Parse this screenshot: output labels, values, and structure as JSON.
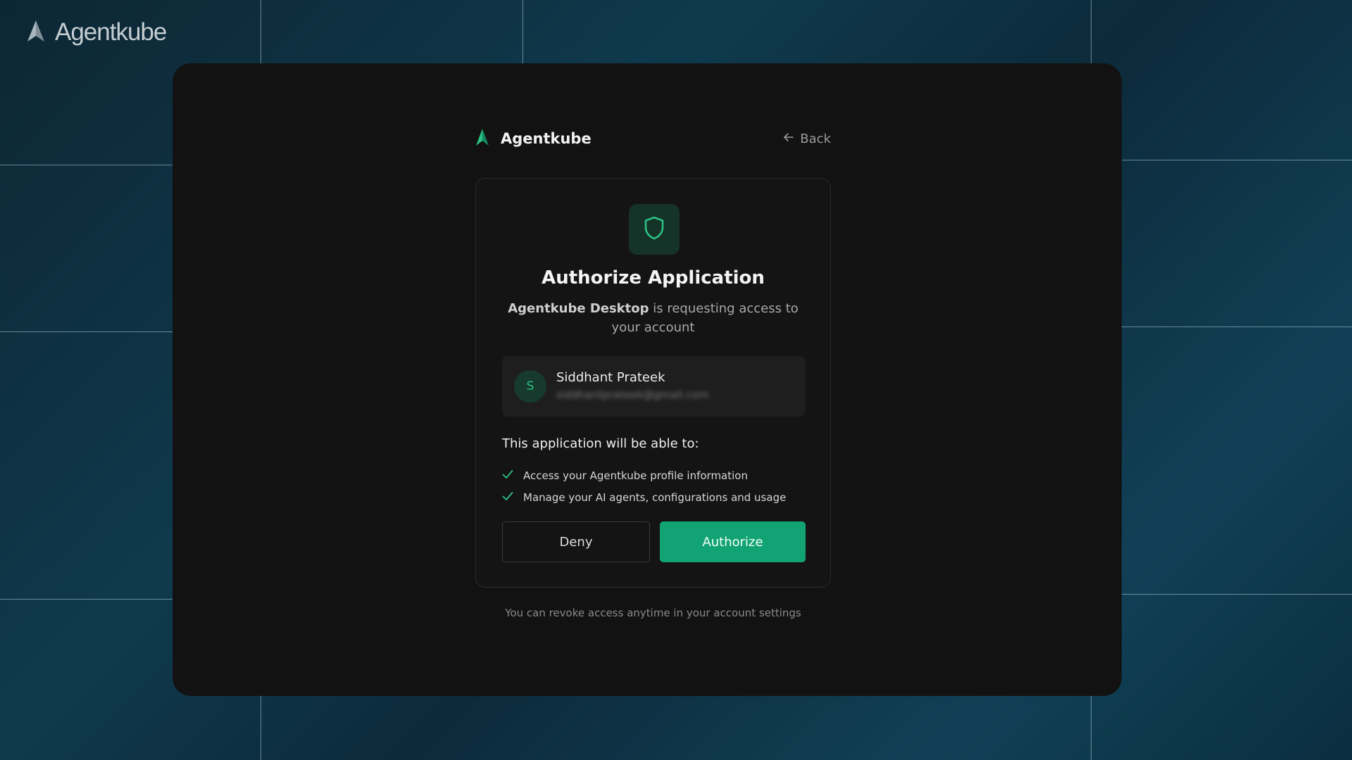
{
  "corner_brand": {
    "name": "Agentkube",
    "logo_icon": "agentkube-logo-icon"
  },
  "header": {
    "brand_name": "Agentkube",
    "back_label": "Back",
    "back_icon": "arrow-left-icon"
  },
  "card": {
    "icon": "shield-icon",
    "title": "Authorize Application",
    "requesting_app": "Agentkube Desktop",
    "request_text": " is requesting access to your account",
    "account": {
      "avatar_initial": "S",
      "name": "Siddhant Prateek",
      "email": "siddhantprateek@gmail.com"
    },
    "permissions_title": "This application will be able to:",
    "permissions": [
      "Access your Agentkube profile information",
      "Manage your AI agents, configurations and usage"
    ],
    "deny_label": "Deny",
    "authorize_label": "Authorize"
  },
  "footer_note": "You can revoke access anytime in your account settings",
  "colors": {
    "accent": "#12a374",
    "logo_green": "#2bbf85",
    "modal_bg": "#121212",
    "card_border": "#2b2b2b"
  }
}
